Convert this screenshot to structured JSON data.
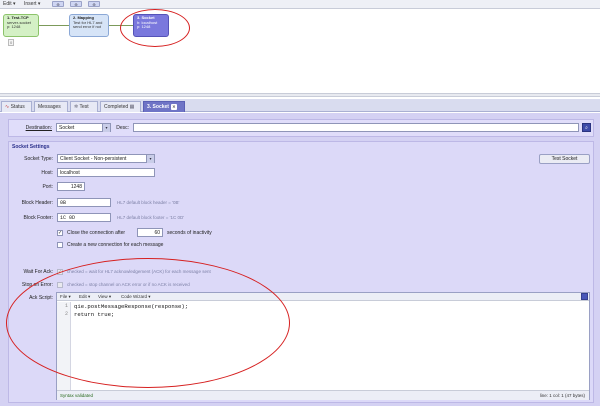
{
  "toolbar": {
    "edit": "Edit ▾",
    "insert": "Insert ▾",
    "btn1": "⊕",
    "btn2": "⊕",
    "btn3": "⊕"
  },
  "flow": {
    "nodes": [
      {
        "title": "1. Test-TCP",
        "line2": "server-socket",
        "line3": "p: 1248"
      },
      {
        "title": "2. Mapping",
        "line2": "Test for HL7 and",
        "line3": "send error if not"
      },
      {
        "title": "3. Socket",
        "line2": "h: localhost",
        "line3": "p: 1248"
      }
    ],
    "badge": "0"
  },
  "tabs": [
    {
      "label": "Status",
      "active": false
    },
    {
      "label": "Messages",
      "active": false
    },
    {
      "label": "Test",
      "active": false
    },
    {
      "label": "Completed",
      "active": false
    },
    {
      "label": "3. Socket",
      "active": true
    }
  ],
  "destination": {
    "label": "Destination:",
    "value": "Socket",
    "desc_label": "Desc:",
    "desc_value": ""
  },
  "socket_settings": {
    "title": "Socket Settings",
    "type_label": "Socket Type:",
    "type_value": "Client Socket - Non-persistent",
    "test_button": "Test Socket",
    "host_label": "Host:",
    "host_value": "localhost",
    "port_label": "Port:",
    "port_value": "1248",
    "block_header_label": "Block Header:",
    "block_header_value": "0B",
    "block_header_hint": "HL7 default block header = '0B'",
    "block_footer_label": "Block Footer:",
    "block_footer_value": "1C 0D",
    "block_footer_hint": "HL7 default block footer = '1C 0D'",
    "close_label": "Close the connection after",
    "close_value": "60",
    "close_suffix": "seconds of inactivity",
    "new_conn_label": "Create a new connection for each message"
  },
  "ack": {
    "wait_label": "Wait For Ack:",
    "wait_hint": "checked = wait for HL7 acknowledgement (ACK) for each message sent",
    "stop_label": "Stop on Error:",
    "stop_hint": "checked = stop channel on ACK error or if no ACK is received",
    "script_label": "Ack Script:"
  },
  "editor": {
    "menus": [
      "File ▾",
      "Edit ▾",
      "View ▾",
      "Code Wizard ▾"
    ],
    "lines": [
      "qie.postMessageResponse(response);",
      "return true;"
    ],
    "line_numbers": [
      "1",
      "2"
    ],
    "status_left": "Syntax validated",
    "status_right": "line: 1  col: 1  (47 bytes)"
  },
  "colors": {
    "annotation": "#d62020",
    "active_tab": "#6f74c6",
    "panel": "#d4d1f3"
  }
}
